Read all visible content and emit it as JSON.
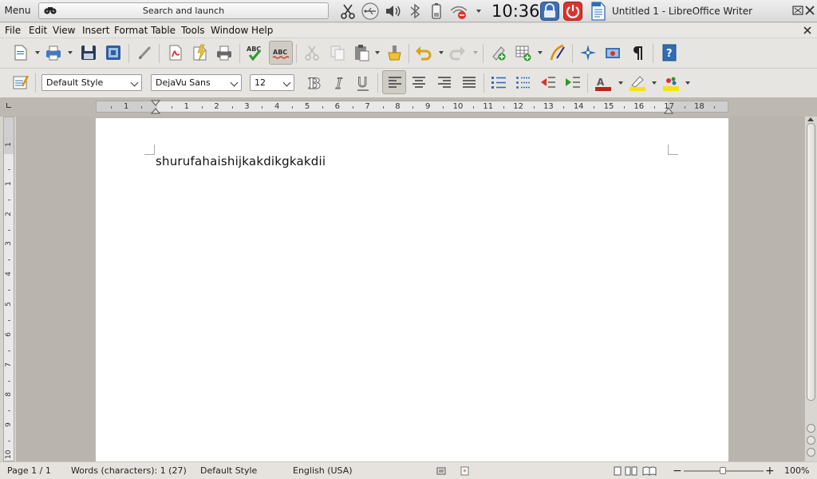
{
  "panel": {
    "menu_label": "Menu",
    "launcher_label": "Search and launch",
    "clock": "10:36",
    "window_title": "Untitled 1 - LibreOffice Writer"
  },
  "menubar": {
    "items": [
      "File",
      "Edit",
      "View",
      "Insert",
      "Format",
      "Table",
      "Tools",
      "Window",
      "Help"
    ]
  },
  "formatting": {
    "paragraph_style": "Default Style",
    "font_name": "DejaVu Sans",
    "font_size": "12"
  },
  "ruler": {
    "ticks": [
      "1",
      "1",
      "2",
      "3",
      "4",
      "5",
      "6",
      "7",
      "8",
      "9",
      "10",
      "11",
      "12",
      "13",
      "14",
      "15",
      "16",
      "17",
      "18"
    ],
    "vticks": [
      "1",
      "1",
      "2",
      "3",
      "4",
      "5",
      "6",
      "7",
      "8",
      "9",
      "10"
    ]
  },
  "document": {
    "text": "shurufahaishijkakdikgkakdii"
  },
  "statusbar": {
    "page": "Page 1 / 1",
    "words": "Words (characters): 1 (27)",
    "style": "Default Style",
    "language": "English (USA)",
    "zoom": "100%"
  },
  "colors": {
    "accent_blue": "#2f6db5",
    "close_red": "#d9342b",
    "spell_green": "#2a9a2a"
  },
  "icons": {
    "toolbar1": [
      "new-document-icon",
      "print-icon",
      "save-icon",
      "save-as-icon",
      "edit-mode-icon",
      "export-pdf-icon",
      "direct-export-icon",
      "print-preview-icon",
      "spellcheck-icon",
      "autospellcheck-icon",
      "cut-icon",
      "copy-icon",
      "paste-icon",
      "clone-formatting-icon",
      "undo-icon",
      "redo-icon",
      "insert-image-icon",
      "insert-table-icon",
      "draw-functions-icon",
      "navigator-icon",
      "gallery-icon",
      "formatting-marks-icon",
      "help-icon"
    ],
    "toolbar2": [
      "styles-icon",
      "bold-icon",
      "italic-icon",
      "underline-icon",
      "align-left-icon",
      "align-center-icon",
      "align-right-icon",
      "justify-icon",
      "numbered-list-icon",
      "bullet-list-icon",
      "decrease-indent-icon",
      "increase-indent-icon",
      "font-color-icon",
      "highlight-icon",
      "background-color-icon"
    ]
  }
}
